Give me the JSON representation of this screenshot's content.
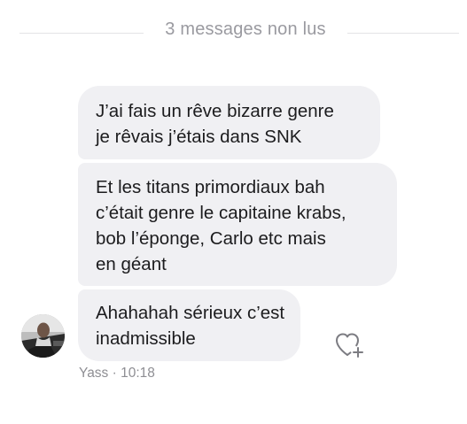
{
  "unread_separator": {
    "label": "3 messages non lus"
  },
  "messages": [
    {
      "lines": [
        "J’ai fais un rêve bizarre genre",
        "je rêvais j’étais dans SNK"
      ]
    },
    {
      "lines": [
        "Et les titans primordiaux bah",
        "c’était genre le capitaine krabs,",
        "bob l’éponge, Carlo etc mais",
        "en géant"
      ]
    },
    {
      "lines": [
        "Ahahahah sérieux c’est",
        "inadmissible"
      ]
    }
  ],
  "sender": {
    "name": "Yass",
    "separator": " · ",
    "time": "10:18"
  },
  "icons": {
    "react": "heart-plus-icon",
    "avatar": "user-avatar"
  },
  "colors": {
    "bubble_bg": "#f0f0f3",
    "meta_text": "#8e8e93",
    "divider": "#e3e3e6"
  }
}
